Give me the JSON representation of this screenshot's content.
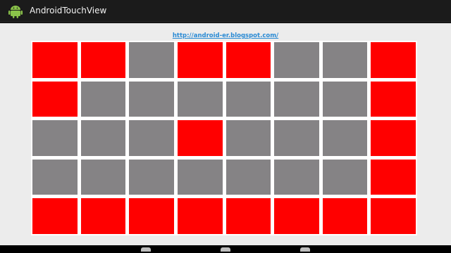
{
  "app": {
    "title": "AndroidTouchView"
  },
  "content": {
    "link_text": "http://android-er.blogspot.com/"
  },
  "grid": {
    "rows": [
      [
        "red",
        "red",
        "gray",
        "red",
        "red",
        "gray",
        "gray",
        "red"
      ],
      [
        "red",
        "gray",
        "gray",
        "gray",
        "gray",
        "gray",
        "gray",
        "red"
      ],
      [
        "gray",
        "gray",
        "gray",
        "red",
        "gray",
        "gray",
        "gray",
        "red"
      ],
      [
        "gray",
        "gray",
        "gray",
        "gray",
        "gray",
        "gray",
        "gray",
        "red"
      ],
      [
        "red",
        "red",
        "red",
        "red",
        "red",
        "red",
        "red",
        "red"
      ]
    ],
    "colors": {
      "red": "#ff0000",
      "gray": "#858385"
    }
  },
  "nav": {
    "buttons": [
      "back-icon",
      "home-icon",
      "recents-icon"
    ]
  }
}
